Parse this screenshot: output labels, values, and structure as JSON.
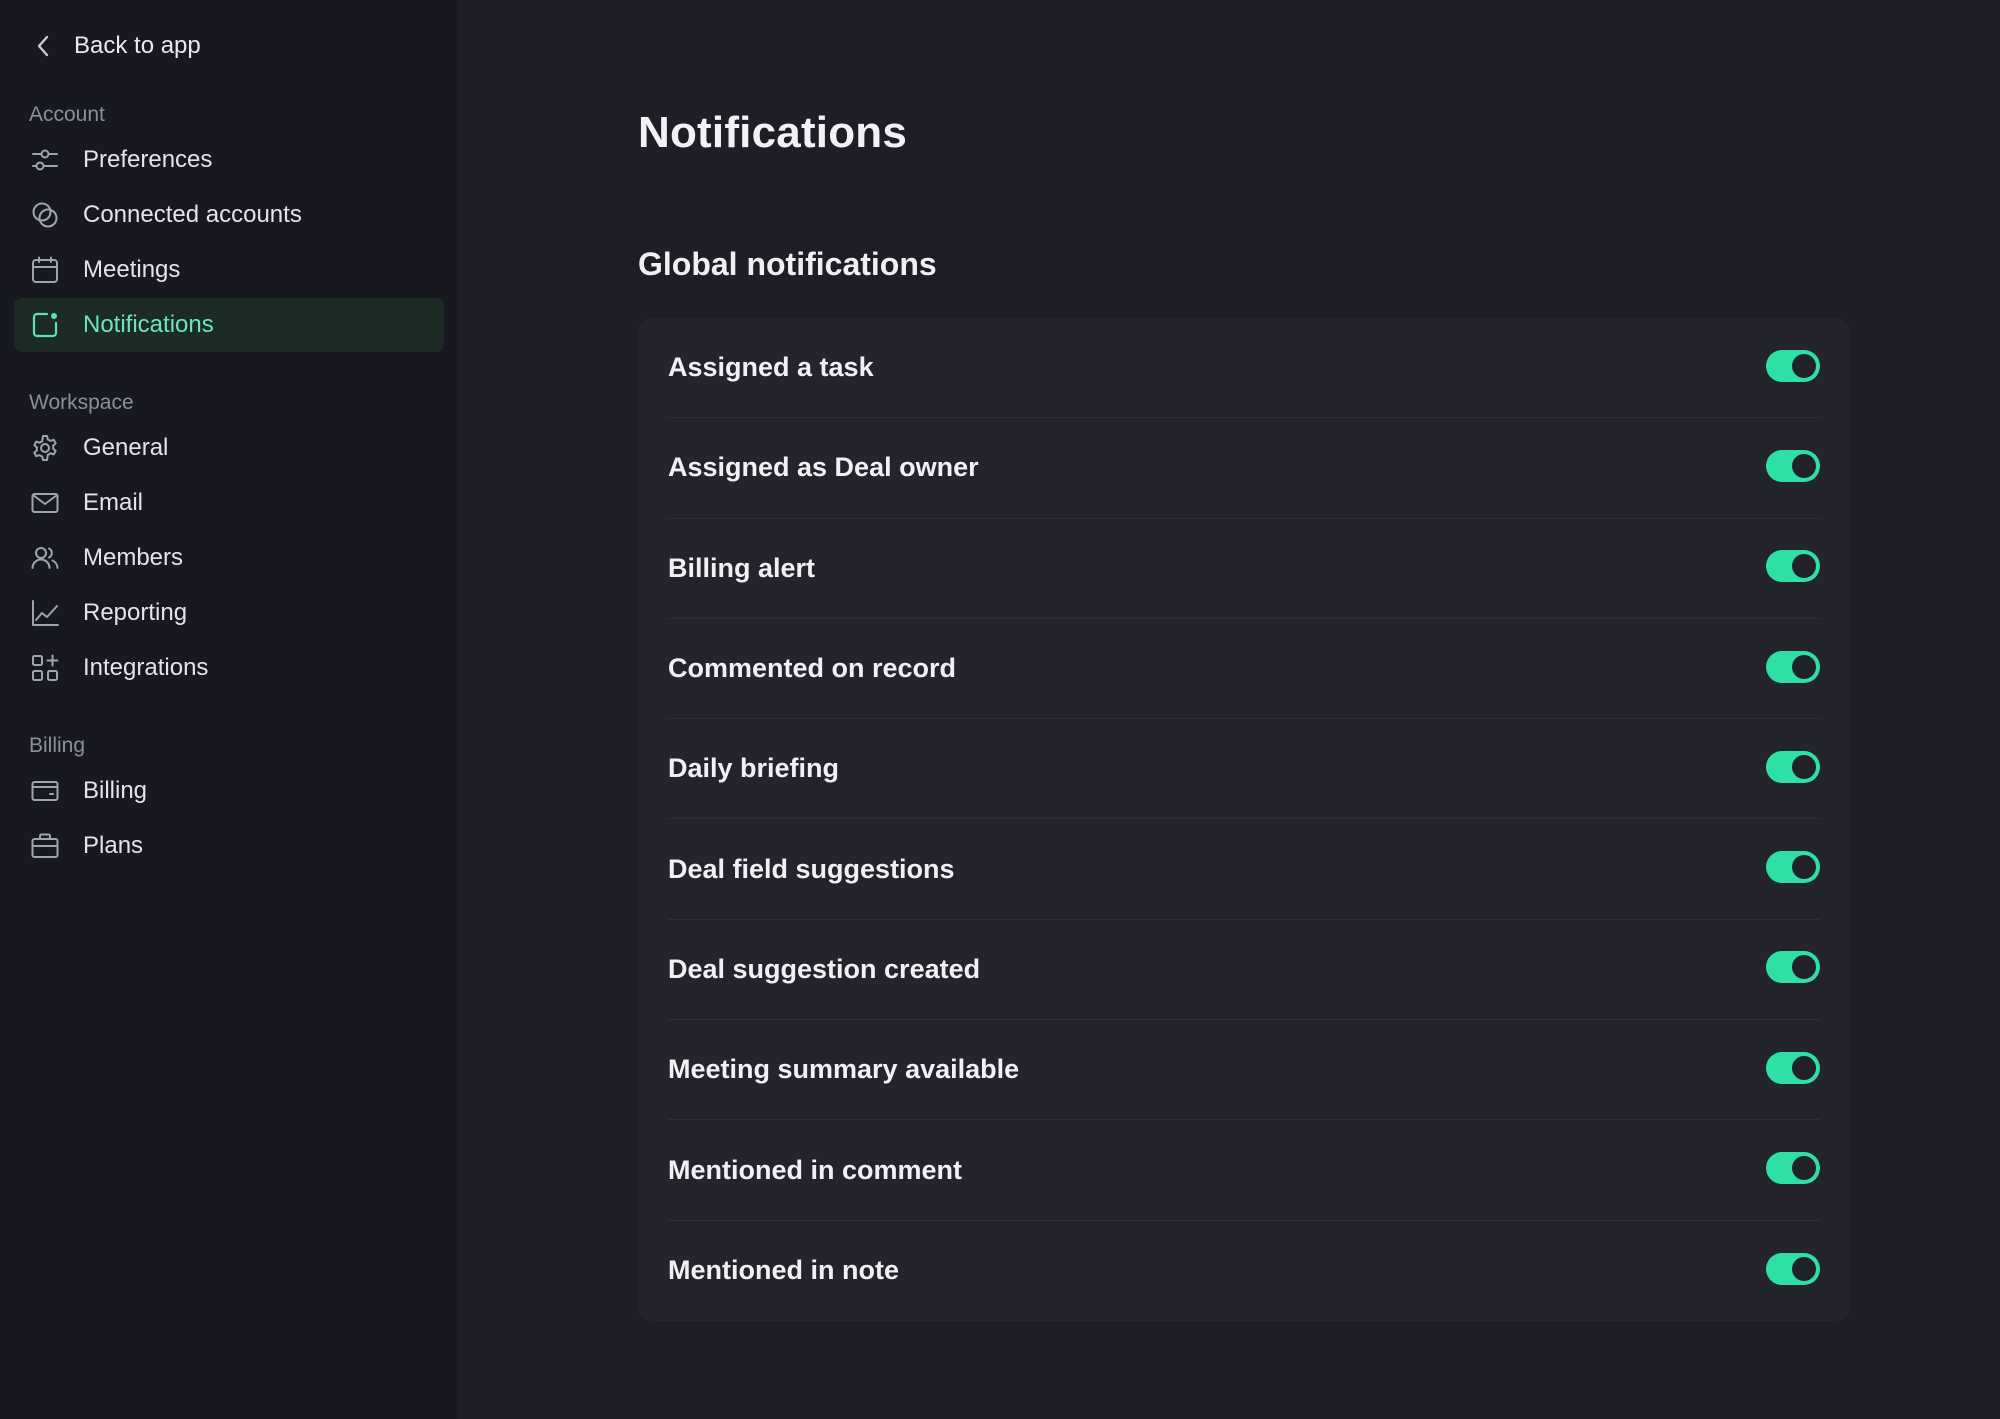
{
  "sidebar": {
    "back_label": "Back to app",
    "sections": [
      {
        "title": "Account",
        "items": [
          {
            "label": "Preferences",
            "icon": "sliders-icon",
            "active": false
          },
          {
            "label": "Connected accounts",
            "icon": "link-circles-icon",
            "active": false
          },
          {
            "label": "Meetings",
            "icon": "calendar-icon",
            "active": false
          },
          {
            "label": "Notifications",
            "icon": "notification-badge-icon",
            "active": true
          }
        ]
      },
      {
        "title": "Workspace",
        "items": [
          {
            "label": "General",
            "icon": "gear-icon",
            "active": false
          },
          {
            "label": "Email",
            "icon": "envelope-icon",
            "active": false
          },
          {
            "label": "Members",
            "icon": "users-icon",
            "active": false
          },
          {
            "label": "Reporting",
            "icon": "line-chart-icon",
            "active": false
          },
          {
            "label": "Integrations",
            "icon": "grid-plus-icon",
            "active": false
          }
        ]
      },
      {
        "title": "Billing",
        "items": [
          {
            "label": "Billing",
            "icon": "credit-card-icon",
            "active": false
          },
          {
            "label": "Plans",
            "icon": "briefcase-icon",
            "active": false
          }
        ]
      }
    ]
  },
  "main": {
    "title": "Notifications",
    "section_title": "Global notifications",
    "settings": [
      {
        "label": "Assigned a task",
        "enabled": true
      },
      {
        "label": "Assigned as Deal owner",
        "enabled": true
      },
      {
        "label": "Billing alert",
        "enabled": true
      },
      {
        "label": "Commented on record",
        "enabled": true
      },
      {
        "label": "Daily briefing",
        "enabled": true
      },
      {
        "label": "Deal field suggestions",
        "enabled": true
      },
      {
        "label": "Deal suggestion created",
        "enabled": true
      },
      {
        "label": "Meeting summary available",
        "enabled": true
      },
      {
        "label": "Mentioned in comment",
        "enabled": true
      },
      {
        "label": "Mentioned in note",
        "enabled": true
      }
    ]
  },
  "colors": {
    "accent": "#2fe0a6",
    "active_nav_bg": "#1d2b27",
    "active_nav_text": "#6fe3c0",
    "sidebar_bg": "#181920",
    "main_bg": "#1e1f26",
    "card_bg": "#23242c"
  }
}
